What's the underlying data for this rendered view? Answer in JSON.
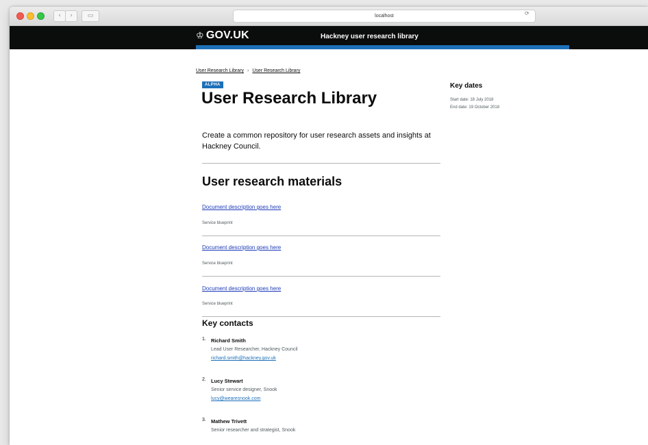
{
  "browser": {
    "url": "localhost",
    "back_glyph": "‹",
    "fwd_glyph": "›",
    "tabs_glyph": "▭",
    "reload_glyph": "⟳"
  },
  "header": {
    "crown_glyph": "♔",
    "logo": "GOV.UK",
    "service_name": "Hackney user research library"
  },
  "breadcrumbs": [
    "User Research Library",
    "User Research Library"
  ],
  "breadcrumb_separator": "›",
  "phase_tag": "ALPHA",
  "title": "User Research Library",
  "lead": "Create a common repository for user research assets and insights at Hackney Council.",
  "materials_heading": "User research materials",
  "documents": [
    {
      "title": "Document description goes here",
      "meta": "Service blueprint"
    },
    {
      "title": "Document description goes here",
      "meta": "Service blueprint"
    },
    {
      "title": "Document description goes here",
      "meta": "Service blueprint"
    }
  ],
  "contacts_heading": "Key contacts",
  "contacts": [
    {
      "num": "1.",
      "name": "Richard Smith",
      "role": "Lead User Researcher, Hackney Council",
      "email": "richard.smith@hackney.gov.uk"
    },
    {
      "num": "2.",
      "name": "Lucy Stewart",
      "role": "Senior service designer, Snook",
      "email": "lucy@wearesnook.com"
    },
    {
      "num": "3.",
      "name": "Mathew Trivett",
      "role": "Senior researcher and strategist, Snook",
      "email": ""
    }
  ],
  "key_dates": {
    "heading": "Key dates",
    "start": "Start date: 18 July 2018",
    "end": "End date: 19 October 2018"
  },
  "colors": {
    "header_bg": "#0b0c0c",
    "brand_blue": "#1d70b8",
    "link": "#1d3ab8",
    "text": "#0b0c0c"
  }
}
